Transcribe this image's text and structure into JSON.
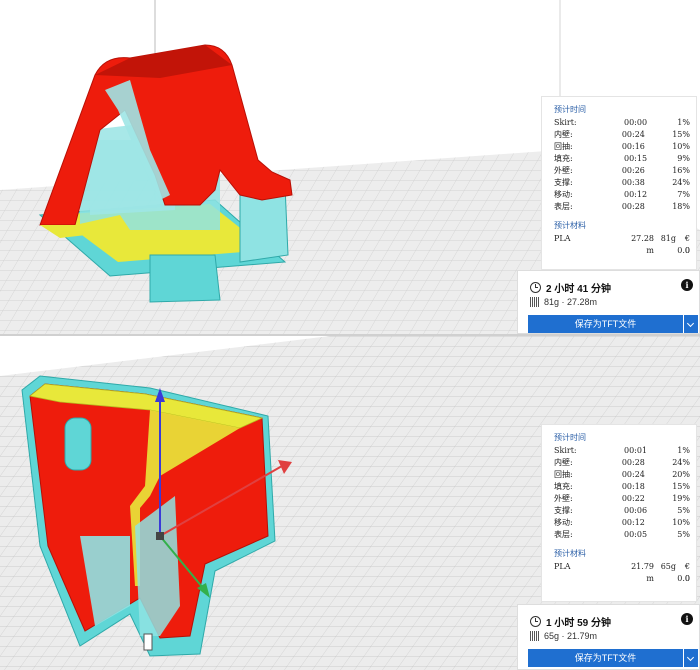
{
  "panels": [
    {
      "stats": {
        "time_header": "预计时间",
        "rows": [
          {
            "label": "Skirt:",
            "time": "00:00",
            "percent": "1%"
          },
          {
            "label": "内壁:",
            "time": "00:24",
            "percent": "15%"
          },
          {
            "label": "回抽:",
            "time": "00:16",
            "percent": "10%"
          },
          {
            "label": "填充:",
            "time": "00:15",
            "percent": "9%"
          },
          {
            "label": "外壁:",
            "time": "00:26",
            "percent": "16%"
          },
          {
            "label": "支撑:",
            "time": "00:38",
            "percent": "24%"
          },
          {
            "label": "移动:",
            "time": "00:12",
            "percent": "7%"
          },
          {
            "label": "表层:",
            "time": "00:28",
            "percent": "18%"
          }
        ],
        "material_header": "预计材料",
        "material": {
          "name": "PLA",
          "length": "27.28",
          "weight": "81g",
          "cost": "€ 0.0",
          "unit": "m",
          "unit_value": "0"
        }
      },
      "summary": {
        "time": "2 小时 41 分钟",
        "material": "81g · 27.28m",
        "save_label": "保存为TFT文件"
      }
    },
    {
      "stats": {
        "time_header": "预计时间",
        "rows": [
          {
            "label": "Skirt:",
            "time": "00:01",
            "percent": "1%"
          },
          {
            "label": "内壁:",
            "time": "00:28",
            "percent": "24%"
          },
          {
            "label": "回抽:",
            "time": "00:24",
            "percent": "20%"
          },
          {
            "label": "填充:",
            "time": "00:18",
            "percent": "15%"
          },
          {
            "label": "外壁:",
            "time": "00:22",
            "percent": "19%"
          },
          {
            "label": "支撑:",
            "time": "00:06",
            "percent": "5%"
          },
          {
            "label": "移动:",
            "time": "00:12",
            "percent": "10%"
          },
          {
            "label": "表层:",
            "time": "00:05",
            "percent": "5%"
          }
        ],
        "material_header": "预计材料",
        "material": {
          "name": "PLA",
          "length": "21.79",
          "weight": "65g",
          "cost": "€ 0.0",
          "unit": "m",
          "unit_value": "0"
        }
      },
      "summary": {
        "time": "1 小时 59 分钟",
        "material": "65g · 21.79m",
        "save_label": "保存为TFT文件"
      }
    }
  ],
  "colors": {
    "model": "#ee1c0c",
    "shell": "#5fd6d6",
    "infill": "#e8e83a",
    "accent": "#1f6fd0"
  },
  "icons": [
    "clock-icon",
    "spool-icon",
    "info-icon",
    "chevron-down-icon"
  ]
}
